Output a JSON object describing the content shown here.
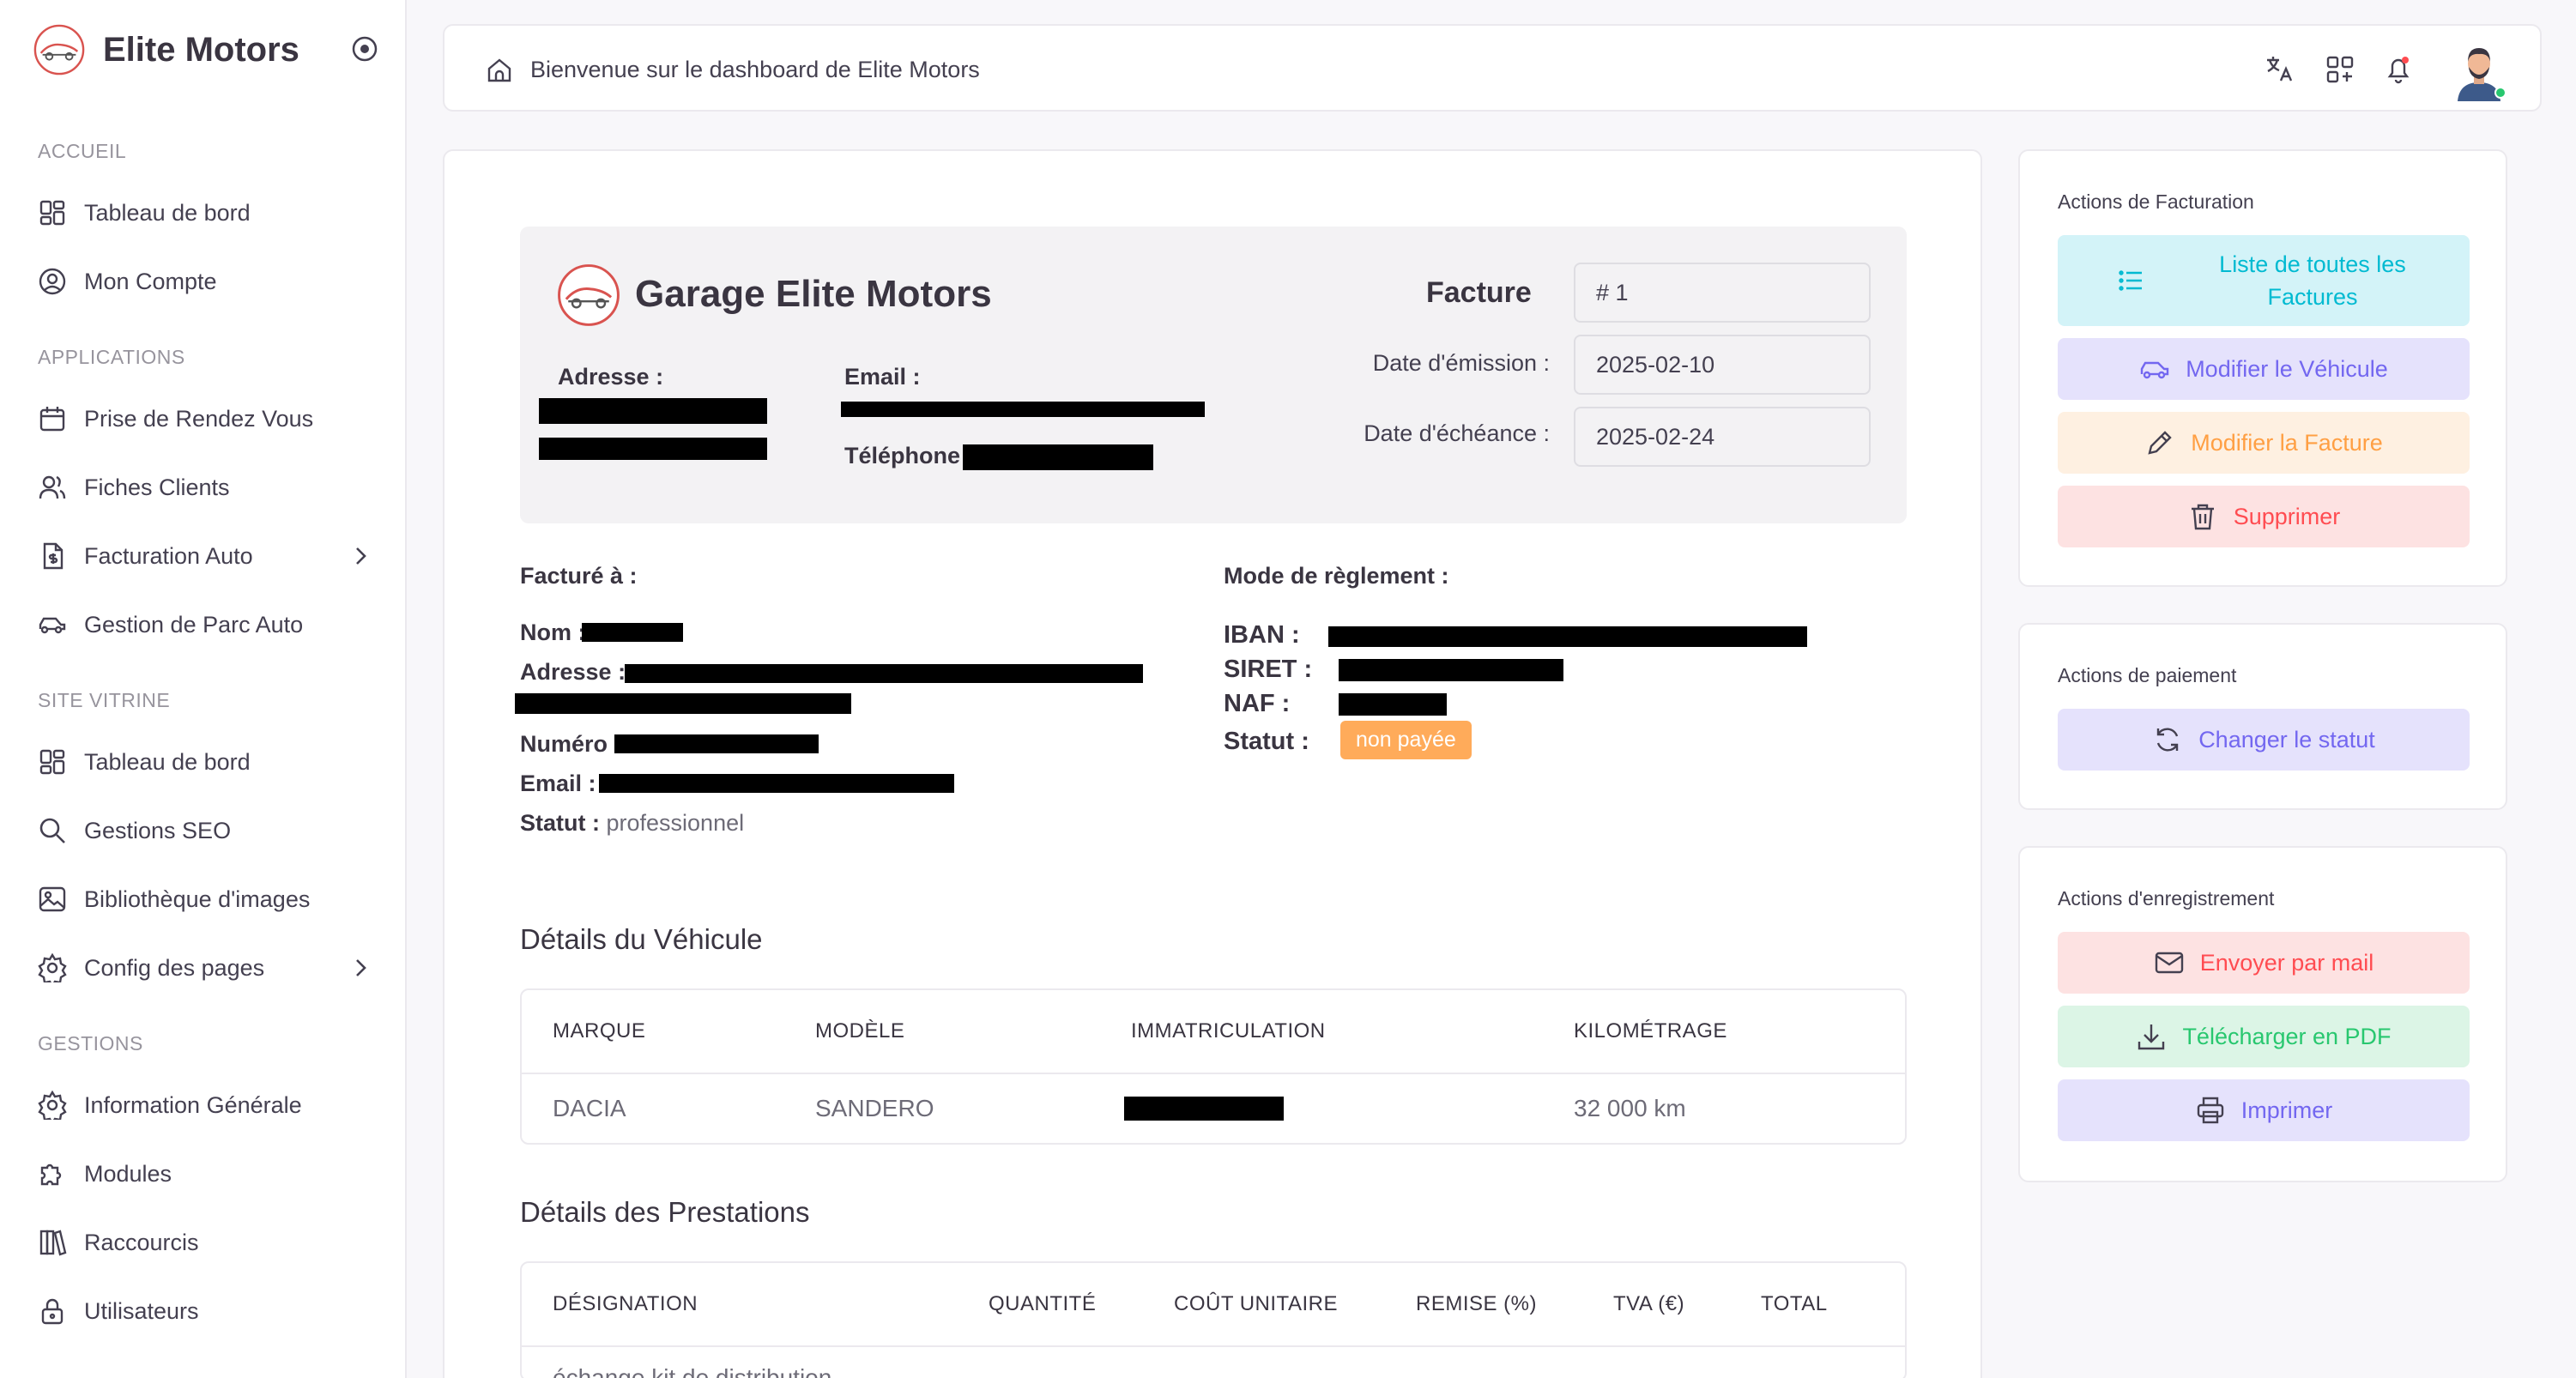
{
  "brand": {
    "name": "Elite Motors"
  },
  "sidebar": {
    "sections": [
      {
        "label": "ACCUEIL"
      },
      {
        "label": "APPLICATIONS"
      },
      {
        "label": "SITE VITRINE"
      },
      {
        "label": "GESTIONS"
      }
    ],
    "items": [
      {
        "label": "Tableau de bord",
        "icon": "dashboard-icon"
      },
      {
        "label": "Mon Compte",
        "icon": "user-circle-icon"
      },
      {
        "label": "Prise de Rendez Vous",
        "icon": "calendar-icon"
      },
      {
        "label": "Fiches Clients",
        "icon": "users-icon"
      },
      {
        "label": "Facturation Auto",
        "icon": "invoice-icon"
      },
      {
        "label": "Gestion de Parc Auto",
        "icon": "car-icon"
      },
      {
        "label": "Tableau de bord",
        "icon": "dashboard-icon"
      },
      {
        "label": "Gestions SEO",
        "icon": "search-icon"
      },
      {
        "label": "Bibliothèque d'images",
        "icon": "image-icon"
      },
      {
        "label": "Config des pages",
        "icon": "settings-icon"
      },
      {
        "label": "Information Générale",
        "icon": "settings-icon"
      },
      {
        "label": "Modules",
        "icon": "puzzle-icon"
      },
      {
        "label": "Raccourcis",
        "icon": "books-icon"
      },
      {
        "label": "Utilisateurs",
        "icon": "lock-icon"
      }
    ]
  },
  "topbar": {
    "welcome": "Bienvenue sur le dashboard de Elite Motors"
  },
  "invoice": {
    "garage_name": "Garage Elite Motors",
    "address_label": "Adresse :",
    "email_label": "Email :",
    "phone_label": "Téléphone :",
    "facture_label": "Facture",
    "facture_number": "# 1",
    "emission_label": "Date d'émission :",
    "emission_value": "2025-02-10",
    "echeance_label": "Date d'échéance :",
    "echeance_value": "2025-02-24",
    "billed_title": "Facturé à :",
    "billed": {
      "nom_label": "Nom :",
      "adresse_label": "Adresse :",
      "numero_label": "Numéro :",
      "email_label": "Email :",
      "statut_label": "Statut :",
      "statut_value": "professionnel"
    },
    "payment_title": "Mode de règlement :",
    "payment": {
      "iban_label": "IBAN :",
      "siret_label": "SIRET :",
      "naf_label": "NAF :",
      "statut_label": "Statut :",
      "statut_badge": "non payée",
      "badge_color": "#ffab5a"
    },
    "vehicle_title": "Détails du Véhicule",
    "vehicle_headers": [
      "MARQUE",
      "MODÈLE",
      "IMMATRICULATION",
      "KILOMÉTRAGE"
    ],
    "vehicle_row": {
      "marque": "DACIA",
      "modele": "SANDERO",
      "kilometrage": "32 000 km"
    },
    "services_title": "Détails des Prestations",
    "services_headers": [
      "DÉSIGNATION",
      "QUANTITÉ",
      "COÛT UNITAIRE",
      "REMISE (%)",
      "TVA (€)",
      "TOTAL"
    ],
    "services_first_row": "échange kit de distribution"
  },
  "actions": {
    "billing": {
      "title": "Actions de Facturation",
      "list": "Liste de toutes les Factures",
      "edit_vehicle": "Modifier le Véhicule",
      "edit_invoice": "Modifier la Facture",
      "delete": "Supprimer"
    },
    "payment": {
      "title": "Actions de paiement",
      "change_status": "Changer le statut"
    },
    "save": {
      "title": "Actions d'enregistrement",
      "send_mail": "Envoyer par mail",
      "download_pdf": "Télécharger en PDF",
      "print": "Imprimer"
    }
  },
  "colors": {
    "primary": "#7367f0",
    "info": "#00bad1",
    "warning": "#ff9f43",
    "danger": "#ff4c51",
    "success": "#28c76f"
  }
}
